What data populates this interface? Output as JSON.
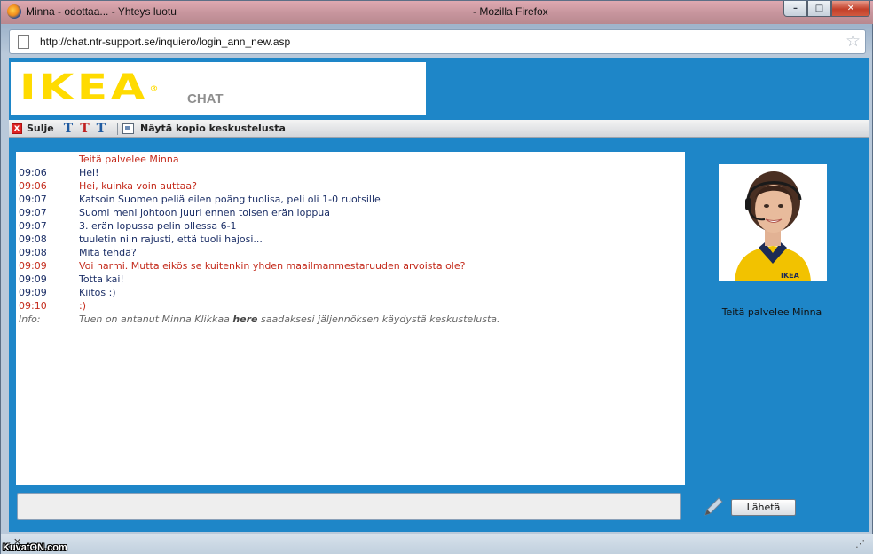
{
  "window": {
    "title_left": "Minna - odottaa... - Yhteys luotu",
    "title_right": "- Mozilla Firefox",
    "minimize": "–",
    "maximize": "□",
    "close": "✕"
  },
  "address": {
    "url": "http://chat.ntr-support.se/inquiero/login_ann_new.asp"
  },
  "brand": {
    "logo": "IKEA",
    "logo_mark": "®",
    "chat_label": "CHAT",
    "color": "#ffdb00"
  },
  "toolbar": {
    "close_label": "Sulje",
    "close_glyph": "x",
    "font_glyph": "T",
    "copy_label": "Näytä kopio keskustelusta"
  },
  "chat": {
    "header": "Teitä palvelee Minna",
    "messages": [
      {
        "time": "09:06",
        "text": "Hei!",
        "role": "user"
      },
      {
        "time": "09:06",
        "text": "Hei, kuinka voin auttaa?",
        "role": "agent"
      },
      {
        "time": "09:07",
        "text": "Katsoin Suomen peliä eilen poäng tuolisa, peli oli 1-0 ruotsille",
        "role": "user"
      },
      {
        "time": "09:07",
        "text": "Suomi meni johtoon juuri ennen toisen erän loppua",
        "role": "user"
      },
      {
        "time": "09:07",
        "text": "3. erän lopussa pelin ollessa 6-1",
        "role": "user"
      },
      {
        "time": "09:08",
        "text": "tuuletin niin rajusti, että tuoli hajosi...",
        "role": "user"
      },
      {
        "time": "09:08",
        "text": "Mitä tehdä?",
        "role": "user"
      },
      {
        "time": "09:09",
        "text": "Voi harmi. Mutta eikös se kuitenkin yhden maailmanmestaruuden arvoista ole?",
        "role": "agent"
      },
      {
        "time": "09:09",
        "text": "Totta kai!",
        "role": "user"
      },
      {
        "time": "09:09",
        "text": "Kiitos :)",
        "role": "user"
      },
      {
        "time": "09:10",
        "text": ":)",
        "role": "agent"
      }
    ],
    "info": {
      "label": "Info:",
      "text_before": "Tuen on antanut Minna Klikkaa ",
      "link": "here",
      "text_after": " saadaksesi jäljennöksen käydystä keskustelusta."
    }
  },
  "agent": {
    "name": "Teitä palvelee Minna",
    "badge_text": "IKEA"
  },
  "composer": {
    "value": "",
    "send_label": "Lähetä"
  },
  "status": {
    "close_glyph": "✕",
    "watermark": "KuvatON.com"
  },
  "colors": {
    "content_bg": "#1e86c8",
    "agent_text": "#c42b1c",
    "user_text": "#1b2e66"
  }
}
